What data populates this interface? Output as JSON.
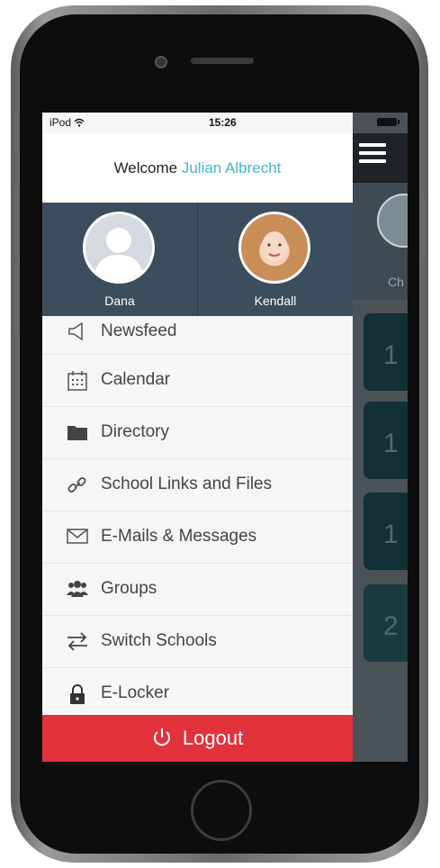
{
  "status_bar": {
    "carrier": "iPod",
    "wifi_icon": "wifi-icon",
    "time": "15:26"
  },
  "welcome": {
    "prefix": "Welcome",
    "user": "Julian Albrecht",
    "user_color": "#3fb7c9"
  },
  "profiles": [
    {
      "name": "Dana",
      "avatar": "silhouette-avatar"
    },
    {
      "name": "Kendall",
      "avatar": "photo-avatar"
    }
  ],
  "menu": [
    {
      "label": "Newsfeed",
      "icon": "megaphone-icon"
    },
    {
      "label": "Calendar",
      "icon": "calendar-icon"
    },
    {
      "label": "Directory",
      "icon": "folder-icon"
    },
    {
      "label": "School Links and Files",
      "icon": "link-icon"
    },
    {
      "label": "E-Mails & Messages",
      "icon": "envelope-icon"
    },
    {
      "label": "Groups",
      "icon": "group-icon"
    },
    {
      "label": "Switch Schools",
      "icon": "swap-icon"
    },
    {
      "label": "E-Locker",
      "icon": "lock-icon"
    }
  ],
  "logout": {
    "label": "Logout",
    "icon": "power-icon",
    "color": "#e2323c"
  },
  "background": {
    "partial_name": "Ch",
    "tiles": [
      "1",
      "1",
      "1",
      "2"
    ]
  }
}
